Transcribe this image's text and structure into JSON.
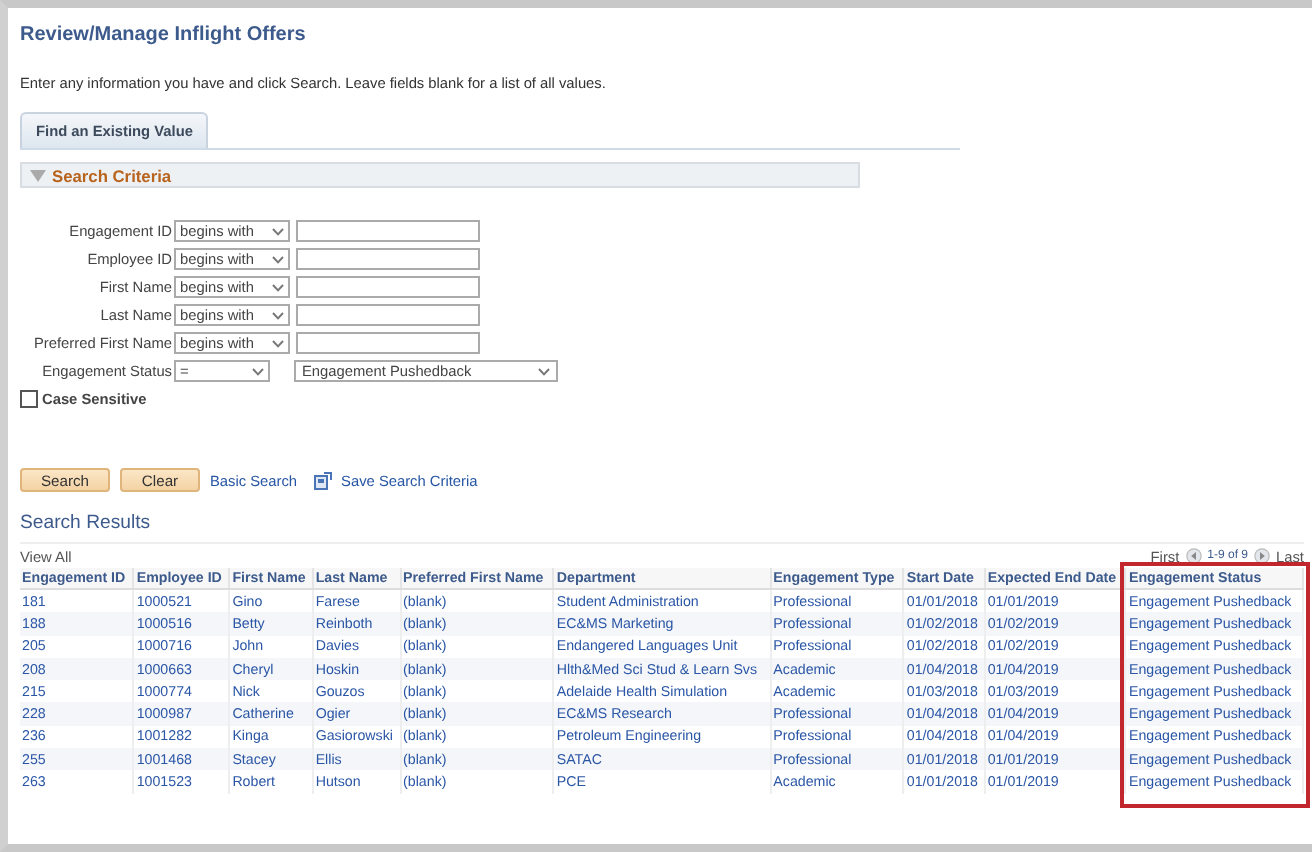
{
  "page": {
    "title": "Review/Manage Inflight Offers",
    "instructions": "Enter any information you have and click Search. Leave fields blank for a list of all values."
  },
  "tabs": [
    {
      "label": "Find an Existing Value",
      "selected": true
    }
  ],
  "search_criteria": {
    "title": "Search Criteria",
    "expanded": true,
    "fields": [
      {
        "kind": "text",
        "label": "Engagement ID",
        "operator": "begins with"
      },
      {
        "kind": "text",
        "label": "Employee ID",
        "operator": "begins with"
      },
      {
        "kind": "text",
        "label": "First Name",
        "operator": "begins with"
      },
      {
        "kind": "text",
        "label": "Last Name",
        "operator": "begins with"
      },
      {
        "kind": "text",
        "label": "Preferred First Name",
        "operator": "begins with"
      },
      {
        "kind": "select",
        "label": "Engagement Status",
        "operator": "=",
        "value": "Engagement Pushedback"
      }
    ],
    "case_sensitive": {
      "label": "Case Sensitive",
      "checked": false
    }
  },
  "actions": {
    "buttons": [
      "Search",
      "Clear"
    ],
    "links": [
      "Basic Search",
      "Save Search Criteria"
    ]
  },
  "results": {
    "title": "Search Results",
    "view_all": "View All",
    "pager": {
      "first": "First",
      "range": "1-9 of 9",
      "last": "Last"
    },
    "columns": [
      {
        "label": "Engagement ID",
        "highlighted": false
      },
      {
        "label": "Employee ID",
        "highlighted": false
      },
      {
        "label": "First Name",
        "highlighted": false
      },
      {
        "label": "Last Name",
        "highlighted": false
      },
      {
        "label": "Preferred First Name",
        "highlighted": false
      },
      {
        "label": "Department",
        "highlighted": false
      },
      {
        "label": "Engagement Type",
        "highlighted": false
      },
      {
        "label": "Start Date",
        "highlighted": false
      },
      {
        "label": "Expected End Date",
        "highlighted": false
      },
      {
        "label": "Engagement Status",
        "highlighted": true
      }
    ],
    "rows": [
      [
        "181",
        "1000521",
        "Gino",
        "Farese",
        "(blank)",
        "Student Administration",
        "Professional",
        "01/01/2018",
        "01/01/2019",
        "Engagement Pushedback"
      ],
      [
        "188",
        "1000516",
        "Betty",
        "Reinboth",
        "(blank)",
        "EC&MS Marketing",
        "Professional",
        "01/02/2018",
        "01/02/2019",
        "Engagement Pushedback"
      ],
      [
        "205",
        "1000716",
        "John",
        "Davies",
        "(blank)",
        "Endangered Languages Unit",
        "Professional",
        "01/02/2018",
        "01/02/2019",
        "Engagement Pushedback"
      ],
      [
        "208",
        "1000663",
        "Cheryl",
        "Hoskin",
        "(blank)",
        "Hlth&Med Sci Stud & Learn Svs",
        "Academic",
        "01/04/2018",
        "01/04/2019",
        "Engagement Pushedback"
      ],
      [
        "215",
        "1000774",
        "Nick",
        "Gouzos",
        "(blank)",
        "Adelaide Health Simulation",
        "Academic",
        "01/03/2018",
        "01/03/2019",
        "Engagement Pushedback"
      ],
      [
        "228",
        "1000987",
        "Catherine",
        "Ogier",
        "(blank)",
        "EC&MS Research",
        "Professional",
        "01/04/2018",
        "01/04/2019",
        "Engagement Pushedback"
      ],
      [
        "236",
        "1001282",
        "Kinga",
        "Gasiorowski",
        "(blank)",
        "Petroleum Engineering",
        "Professional",
        "01/04/2018",
        "01/04/2019",
        "Engagement Pushedback"
      ],
      [
        "255",
        "1001468",
        "Stacey",
        "Ellis",
        "(blank)",
        "SATAC",
        "Professional",
        "01/01/2018",
        "01/01/2019",
        "Engagement Pushedback"
      ],
      [
        "263",
        "1001523",
        "Robert",
        "Hutson",
        "(blank)",
        "PCE",
        "Academic",
        "01/01/2018",
        "01/01/2019",
        "Engagement Pushedback"
      ]
    ]
  }
}
